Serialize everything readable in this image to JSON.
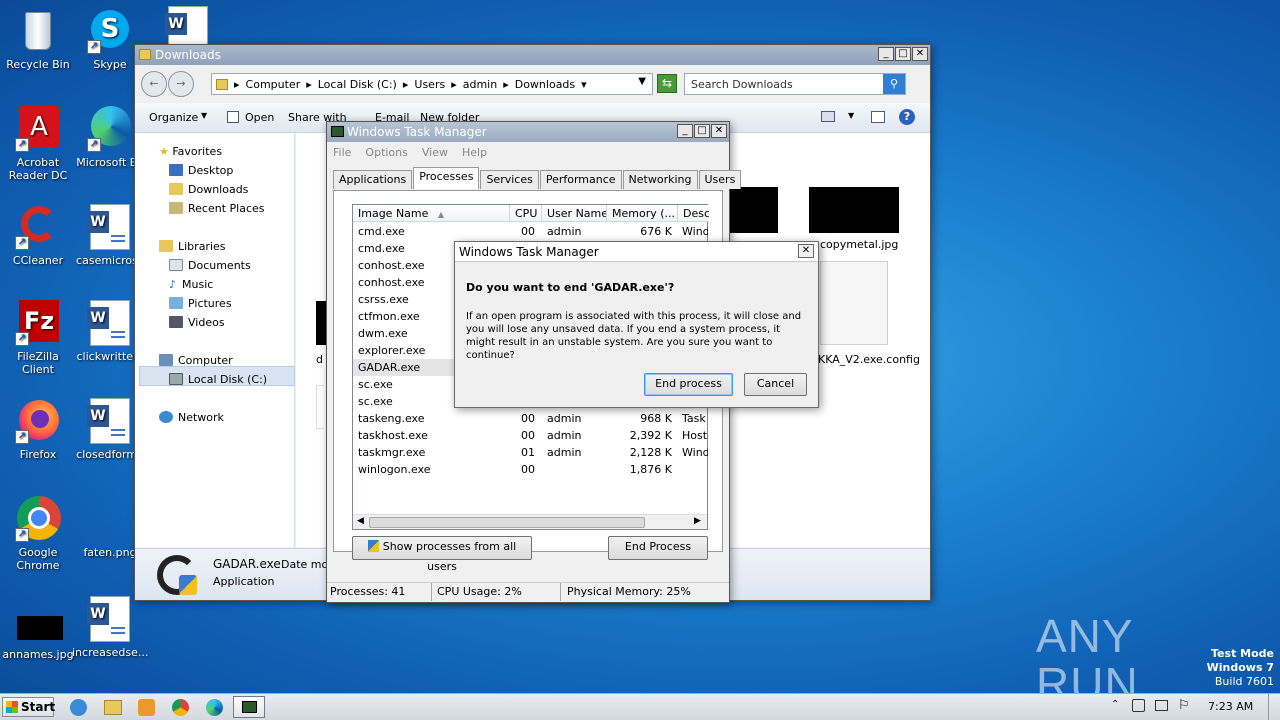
{
  "desktop": {
    "icons": [
      {
        "label": "Recycle Bin",
        "icon": "recycle-bin-icon"
      },
      {
        "label": "Skype",
        "icon": "skype-icon"
      },
      {
        "label": "Acrobat Reader DC",
        "icon": "acrobat-icon"
      },
      {
        "label": "Microsoft Ed",
        "icon": "edge-icon"
      },
      {
        "label": "CCleaner",
        "icon": "ccleaner-icon"
      },
      {
        "label": "casemicrosc",
        "icon": "word-doc-icon"
      },
      {
        "label": "FileZilla Client",
        "icon": "filezilla-icon"
      },
      {
        "label": "clickwritten.",
        "icon": "word-doc-icon"
      },
      {
        "label": "Firefox",
        "icon": "firefox-icon"
      },
      {
        "label": "closedforma",
        "icon": "word-doc-icon"
      },
      {
        "label": "Google Chrome",
        "icon": "chrome-icon"
      },
      {
        "label": "faten.png",
        "icon": "image-icon"
      },
      {
        "label": "annames.jpg",
        "icon": "image-icon"
      },
      {
        "label": "increasedse...",
        "icon": "word-doc-icon"
      }
    ]
  },
  "explorer": {
    "title": "Downloads",
    "breadcrumb": [
      "Computer",
      "Local Disk (C:)",
      "Users",
      "admin",
      "Downloads"
    ],
    "search_placeholder": "Search Downloads",
    "toolbar": {
      "organize": "Organize",
      "open": "Open",
      "share": "Share with",
      "email": "E-mail",
      "new_folder": "New folder"
    },
    "nav": {
      "favorites": "Favorites",
      "desktop": "Desktop",
      "downloads": "Downloads",
      "recent": "Recent Places",
      "libraries": "Libraries",
      "documents": "Documents",
      "music": "Music",
      "pictures": "Pictures",
      "videos": "Videos",
      "computer": "Computer",
      "local_disk": "Local Disk (C:)",
      "network": "Network"
    },
    "files": {
      "copymetal": "copymetal.jpg",
      "config": "KKA_V2.exe.config",
      "partial_d": "d"
    },
    "details": {
      "name": "GADAR.exe",
      "date": "Date mod",
      "type": "Application"
    }
  },
  "taskmgr": {
    "title": "Windows Task Manager",
    "menu": [
      "File",
      "Options",
      "View",
      "Help"
    ],
    "tabs": [
      "Applications",
      "Processes",
      "Services",
      "Performance",
      "Networking",
      "Users"
    ],
    "columns": [
      "Image Name",
      "CPU",
      "User Name",
      "Memory (...",
      "Desc"
    ],
    "rows": [
      {
        "name": "cmd.exe",
        "cpu": "00",
        "user": "admin",
        "mem": "676 K",
        "desc": "Wind"
      },
      {
        "name": "cmd.exe",
        "cpu": "",
        "user": "",
        "mem": "",
        "desc": ""
      },
      {
        "name": "conhost.exe",
        "cpu": "",
        "user": "",
        "mem": "",
        "desc": ""
      },
      {
        "name": "conhost.exe",
        "cpu": "",
        "user": "",
        "mem": "",
        "desc": ""
      },
      {
        "name": "csrss.exe",
        "cpu": "",
        "user": "",
        "mem": "",
        "desc": ""
      },
      {
        "name": "ctfmon.exe",
        "cpu": "",
        "user": "",
        "mem": "",
        "desc": ""
      },
      {
        "name": "dwm.exe",
        "cpu": "",
        "user": "",
        "mem": "",
        "desc": ""
      },
      {
        "name": "explorer.exe",
        "cpu": "",
        "user": "",
        "mem": "",
        "desc": ""
      },
      {
        "name": "GADAR.exe",
        "cpu": "",
        "user": "",
        "mem": "",
        "desc": ""
      },
      {
        "name": "sc.exe",
        "cpu": "",
        "user": "",
        "mem": "",
        "desc": ""
      },
      {
        "name": "sc.exe",
        "cpu": "",
        "user": "",
        "mem": "",
        "desc": ""
      },
      {
        "name": "taskeng.exe",
        "cpu": "00",
        "user": "admin",
        "mem": "968 K",
        "desc": "Task"
      },
      {
        "name": "taskhost.exe",
        "cpu": "00",
        "user": "admin",
        "mem": "2,392 K",
        "desc": "Host"
      },
      {
        "name": "taskmgr.exe",
        "cpu": "01",
        "user": "admin",
        "mem": "2,128 K",
        "desc": "Wind"
      },
      {
        "name": "winlogon.exe",
        "cpu": "00",
        "user": "",
        "mem": "1,876 K",
        "desc": ""
      }
    ],
    "show_all": "Show processes from all users",
    "end_process": "End Process",
    "status": {
      "processes": "Processes: 41",
      "cpu": "CPU Usage: 2%",
      "memory": "Physical Memory: 25%"
    }
  },
  "dialog": {
    "title": "Windows Task Manager",
    "question": "Do you want to end 'GADAR.exe'?",
    "body": "If an open program is associated with this process, it will close and you will lose any unsaved data. If you end a system process, it might result in an unstable system. Are you sure you want to continue?",
    "ok": "End process",
    "cancel": "Cancel"
  },
  "watermark": {
    "text": "ANY RUN",
    "mode": "Test Mode",
    "os": "Windows 7",
    "build": "Build 7601"
  },
  "taskbar": {
    "start": "Start",
    "time": "7:23 AM"
  },
  "colors": {
    "accent": "#3399ff",
    "title_active": "#8fa2ba"
  }
}
